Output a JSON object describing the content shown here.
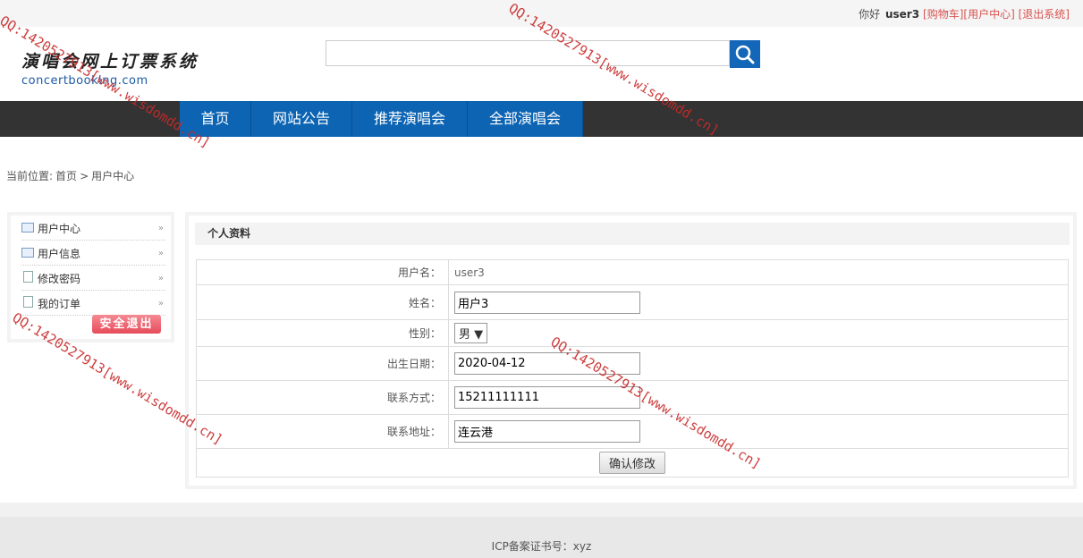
{
  "topbar": {
    "greeting": "你好",
    "username": "user3",
    "links": [
      "[购物车]",
      "[用户中心]",
      "[退出系统]"
    ]
  },
  "logo": {
    "cn": "演唱会网上订票系统",
    "en": "concertbooking.com"
  },
  "search": {
    "value": "",
    "icon": "search-icon"
  },
  "nav": [
    "首页",
    "网站公告",
    "推荐演唱会",
    "全部演唱会"
  ],
  "breadcrumb": {
    "prefix": "当前位置:",
    "home": "首页",
    "sep": ">",
    "current": "用户中心"
  },
  "sidebar": {
    "items": [
      {
        "label": "用户中心",
        "icon": "user-card-icon"
      },
      {
        "label": "用户信息",
        "icon": "user-card-icon"
      },
      {
        "label": "修改密码",
        "icon": "document-icon"
      },
      {
        "label": "我的订单",
        "icon": "document-icon"
      }
    ],
    "logout": "安全退出"
  },
  "profile": {
    "title": "个人资料",
    "username_label": "用户名：",
    "username": "user3",
    "name_label": "姓名：",
    "name": "用户3",
    "gender_label": "性别：",
    "gender": "男",
    "birth_label": "出生日期：",
    "birth": "2020-04-12",
    "phone_label": "联系方式：",
    "phone": "15211111111",
    "address_label": "联系地址：",
    "address": "连云港",
    "submit": "确认修改"
  },
  "footer": {
    "icp": "ICP备案证书号：xyz"
  },
  "watermark": "QQ:1420527913[www.wisdomdd.cn]",
  "colors": {
    "nav_bg": "#333333",
    "nav_item": "#0c64b3",
    "link": "#d9534f",
    "watermark": "#c82a2a"
  }
}
